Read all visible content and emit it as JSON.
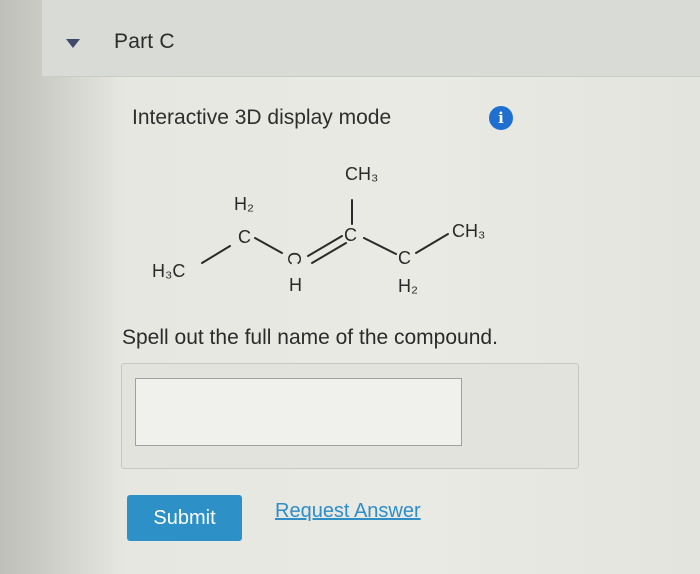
{
  "part": {
    "title": "Part C",
    "expanded": true
  },
  "display_mode": {
    "label": "Interactive 3D display mode",
    "info_icon": "i"
  },
  "structure": {
    "labels": {
      "h3c": "H₃C",
      "h2_top": "H₂",
      "c1": "C",
      "c2_letter": "C",
      "c2_h": "H",
      "ch3_top": "CH₃",
      "c3": "C",
      "c4_letter": "C",
      "c4_h2": "H₂",
      "ch3_right": "CH₃"
    }
  },
  "question": {
    "text": "Spell out the full name of the compound."
  },
  "answer": {
    "value": "",
    "placeholder": ""
  },
  "actions": {
    "submit_label": "Submit",
    "request_answer_label": "Request Answer"
  },
  "colors": {
    "submit_bg": "#2d91c7",
    "link": "#2e8ec6",
    "info_icon": "#1f6fd0",
    "caret": "#3f4a6b"
  }
}
